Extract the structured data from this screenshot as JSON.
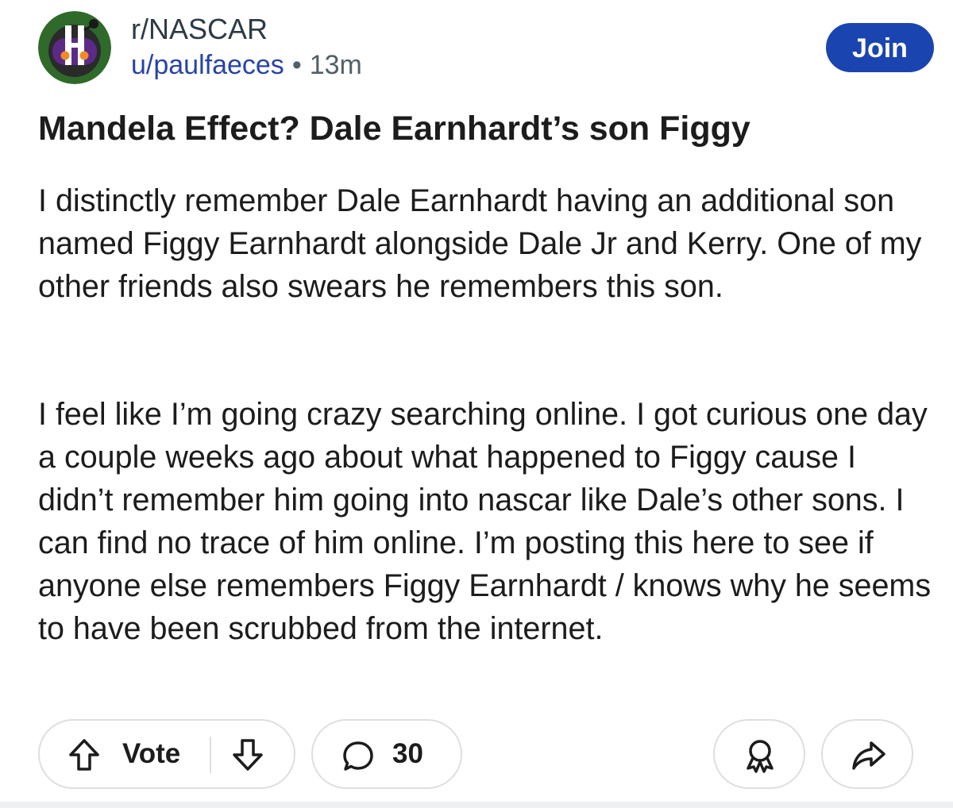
{
  "post": {
    "subreddit": "r/NASCAR",
    "author": "u/paulfaeces",
    "separator": "•",
    "time_ago": "13m",
    "join_label": "Join",
    "title": "Mandela Effect? Dale Earnhardt’s son Figgy",
    "paragraphs": [
      "I distinctly remember Dale Earnhardt having an additional son named Figgy Earnhardt alongside Dale Jr and Kerry. One of my other friends also swears he remembers this son.",
      "I feel like I’m going crazy searching online. I got curious one day a couple weeks ago about what happened to Figgy cause I didn’t remember him going into nascar like Dale’s other sons. I can find no trace of him online. I’m posting this here to see if anyone else remembers Figgy Earnhardt / knows why he seems to have been scrubbed from the internet."
    ]
  },
  "actions": {
    "vote_label": "Vote",
    "comment_count": "30",
    "icons": {
      "upvote": "arrow-up-icon",
      "downvote": "arrow-down-icon",
      "comment": "speech-bubble-icon",
      "award": "award-icon",
      "share": "share-arrow-icon",
      "avatar": "nascar-snoo-avatar"
    }
  },
  "colors": {
    "join_button": "#1a45b0",
    "author_link": "#2743a8",
    "avatar_ring": "#2f6a2a",
    "avatar_purple": "#5b2a86",
    "avatar_orange": "#f08a24",
    "pill_border": "#dcdfe2"
  }
}
